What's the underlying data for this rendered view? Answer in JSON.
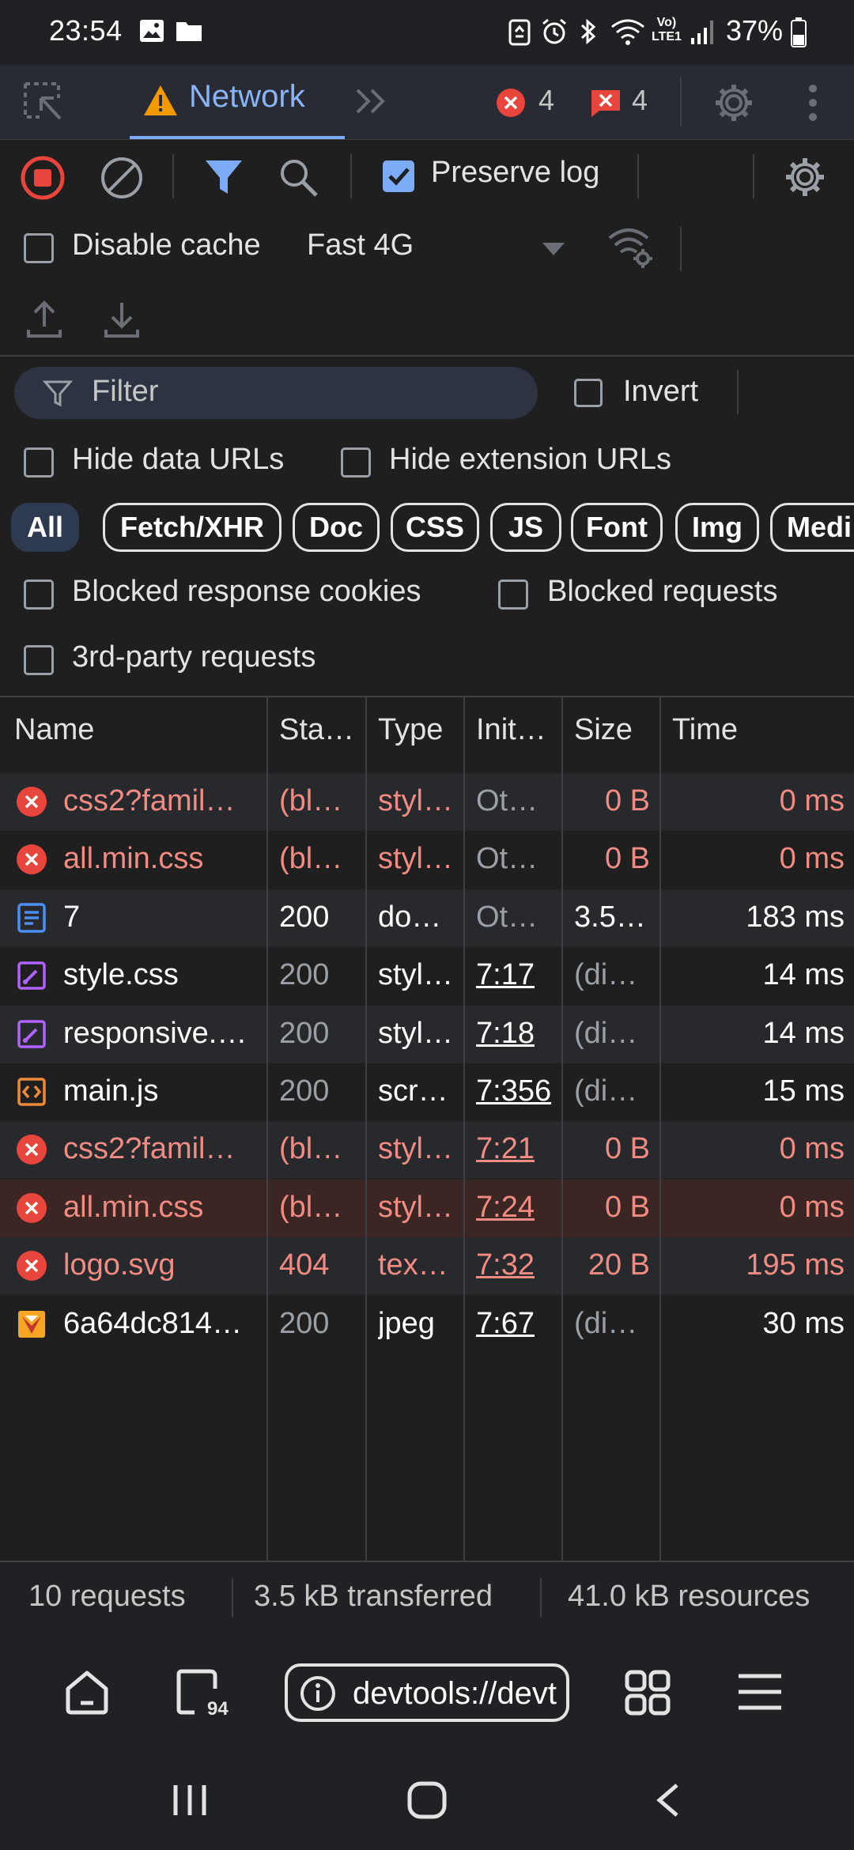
{
  "status_bar": {
    "time": "23:54",
    "battery": "37%",
    "network_label_top": "Vo)",
    "network_label_bottom": "LTE1"
  },
  "devtools_tabs": {
    "active_tab": "Network",
    "error_count": "4",
    "issue_count": "4"
  },
  "toolbar": {
    "preserve_log": {
      "label": "Preserve log",
      "checked": true
    },
    "disable_cache": {
      "label": "Disable cache",
      "checked": false
    },
    "throttling": "Fast 4G"
  },
  "filter": {
    "placeholder": "Filter",
    "invert_label": "Invert",
    "hide_data_urls": "Hide data URLs",
    "hide_extension_urls": "Hide extension URLs",
    "type_chips": [
      "All",
      "Fetch/XHR",
      "Doc",
      "CSS",
      "JS",
      "Font",
      "Img",
      "Medi"
    ],
    "blocked_response_cookies": "Blocked response cookies",
    "blocked_requests": "Blocked requests",
    "third_party_requests": "3rd-party requests"
  },
  "table": {
    "headers": [
      "Name",
      "Sta…",
      "Type",
      "Init…",
      "Size",
      "Time"
    ],
    "rows": [
      {
        "icon": "error-icon",
        "name": "css2?famil…",
        "status": "(bl…",
        "type": "styl…",
        "initiator": "Ot…",
        "size": "0 B",
        "time": "0 ms"
      },
      {
        "icon": "error-icon",
        "name": "all.min.css",
        "status": "(bl…",
        "type": "styl…",
        "initiator": "Ot…",
        "size": "0 B",
        "time": "0 ms"
      },
      {
        "icon": "document-icon",
        "name": "7",
        "status": "200",
        "type": "do…",
        "initiator": "Ot…",
        "size": "3.5…",
        "time": "183 ms"
      },
      {
        "icon": "stylesheet-icon",
        "name": "style.css",
        "status": "200",
        "type": "styl…",
        "initiator": "7:17",
        "size": "(di…",
        "time": "14 ms"
      },
      {
        "icon": "stylesheet-icon",
        "name": "responsive.…",
        "status": "200",
        "type": "styl…",
        "initiator": "7:18",
        "size": "(di…",
        "time": "14 ms"
      },
      {
        "icon": "script-icon",
        "name": "main.js",
        "status": "200",
        "type": "scr…",
        "initiator": "7:356",
        "size": "(di…",
        "time": "15 ms"
      },
      {
        "icon": "error-icon",
        "name": "css2?famil…",
        "status": "(bl…",
        "type": "styl…",
        "initiator": "7:21",
        "size": "0 B",
        "time": "0 ms"
      },
      {
        "icon": "error-icon",
        "name": "all.min.css",
        "status": "(bl…",
        "type": "styl…",
        "initiator": "7:24",
        "size": "0 B",
        "time": "0 ms"
      },
      {
        "icon": "error-icon",
        "name": "logo.svg",
        "status": "404",
        "type": "tex…",
        "initiator": "7:32",
        "size": "20 B",
        "time": "195 ms"
      },
      {
        "icon": "image-icon",
        "name": "6a64dc814…",
        "status": "200",
        "type": "jpeg",
        "initiator": "7:67",
        "size": "(di…",
        "time": "30 ms"
      }
    ]
  },
  "summary": {
    "requests": "10 requests",
    "transferred": "3.5 kB transferred",
    "resources": "41.0 kB resources"
  },
  "browser_bar": {
    "url": "devtools://devt",
    "tab_count": "94"
  },
  "colors": {
    "error": "#f28b82",
    "accent": "#8ab4f8",
    "background": "#1f1f1f"
  }
}
